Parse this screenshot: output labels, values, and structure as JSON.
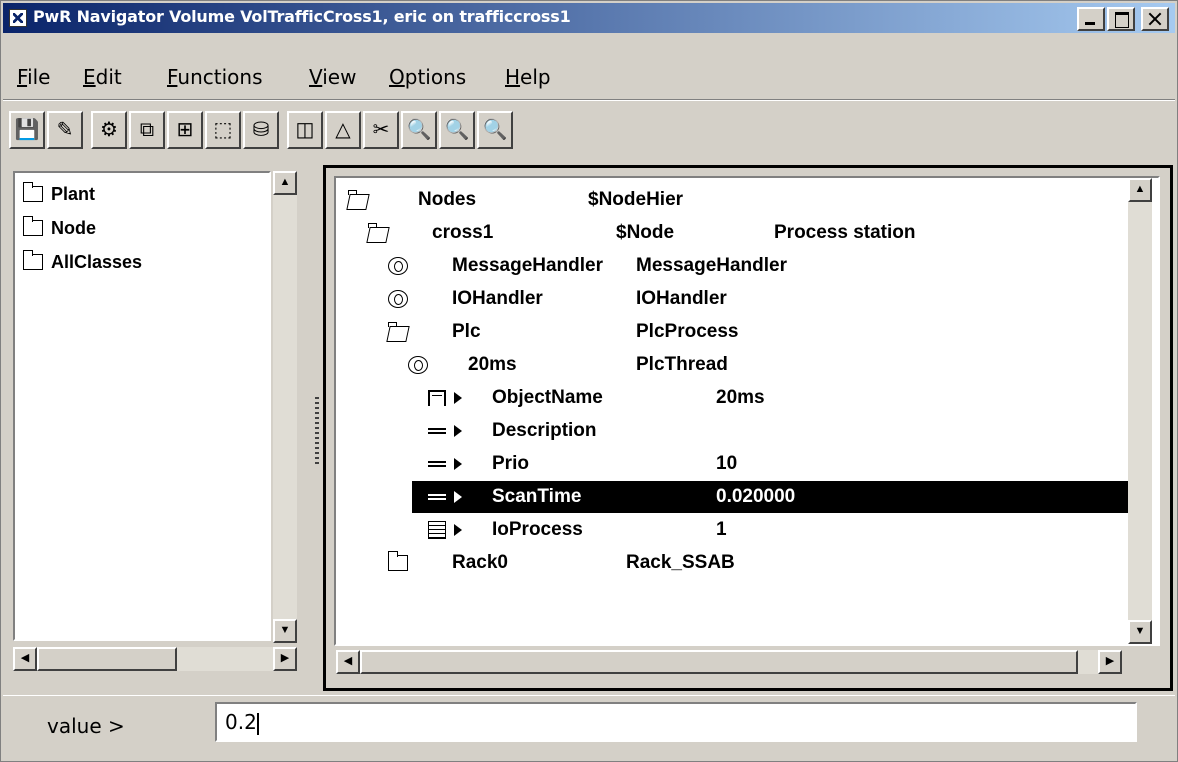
{
  "window": {
    "title": "PwR Navigator Volume VolTrafficCross1, eric on trafficcross1"
  },
  "menu": [
    "File",
    "Edit",
    "Functions",
    "View",
    "Options",
    "Help"
  ],
  "toolbar": [
    {
      "icon": "save-icon",
      "glyph": "💾"
    },
    {
      "icon": "edit-pencil-icon",
      "glyph": "✎"
    },
    {
      "icon": "gear-icon",
      "glyph": "⚙"
    },
    {
      "icon": "tree-hierarchy-icon",
      "glyph": "⧉"
    },
    {
      "icon": "structure-icon",
      "glyph": "⊞"
    },
    {
      "icon": "class-graph-icon",
      "glyph": "⬚"
    },
    {
      "icon": "bucket-icon",
      "glyph": "⛁"
    },
    {
      "icon": "window-split-icon",
      "glyph": "◫"
    },
    {
      "icon": "warning-triangle-icon",
      "glyph": "△"
    },
    {
      "icon": "scissors-tool-icon",
      "glyph": "✂"
    },
    {
      "icon": "zoom-in-icon",
      "glyph": "🔍"
    },
    {
      "icon": "zoom-out-icon",
      "glyph": "🔍"
    },
    {
      "icon": "zoom-reset-icon",
      "glyph": "🔍"
    }
  ],
  "left_tree": [
    "Plant",
    "Node",
    "AllClasses"
  ],
  "right_tree": [
    {
      "icon": "openfolder",
      "name": "Nodes",
      "cls": "$NodeHier",
      "desc": ""
    },
    {
      "icon": "openfolder",
      "name": "cross1",
      "cls": "$Node",
      "desc": "Process station"
    },
    {
      "icon": "object",
      "name": "MessageHandler",
      "cls": "MessageHandler",
      "desc": ""
    },
    {
      "icon": "object",
      "name": "IOHandler",
      "cls": "IOHandler",
      "desc": ""
    },
    {
      "icon": "openfolder",
      "name": "Plc",
      "cls": "PlcProcess",
      "desc": ""
    },
    {
      "icon": "object",
      "name": "20ms",
      "cls": "PlcThread",
      "desc": ""
    },
    {
      "icon": "objname",
      "name": "ObjectName",
      "cls": "20ms",
      "desc": ""
    },
    {
      "icon": "attr",
      "name": "Description",
      "cls": "",
      "desc": ""
    },
    {
      "icon": "attr",
      "name": "Prio",
      "cls": "10",
      "desc": ""
    },
    {
      "icon": "attr",
      "name": "ScanTime",
      "cls": "0.020000",
      "desc": "",
      "selected": true
    },
    {
      "icon": "ioproc",
      "name": "IoProcess",
      "cls": "1",
      "desc": ""
    },
    {
      "icon": "folder",
      "name": "Rack0",
      "cls": "Rack_SSAB",
      "desc": ""
    }
  ],
  "command": {
    "label": "value >",
    "value": "0.2"
  }
}
